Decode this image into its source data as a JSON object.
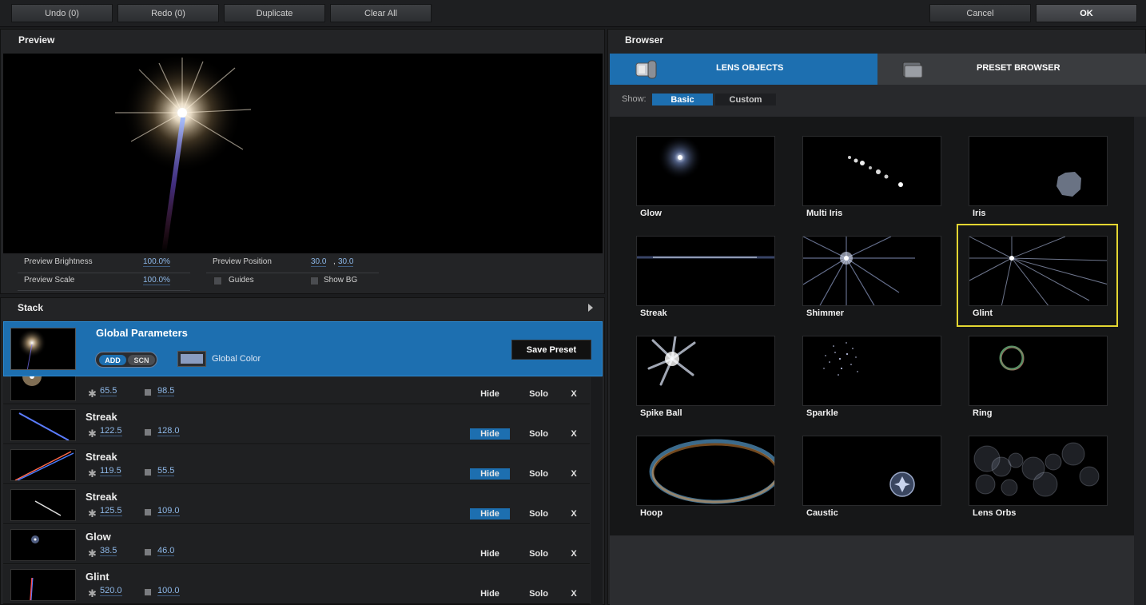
{
  "toolbar": {
    "undo": "Undo (0)",
    "redo": "Redo (0)",
    "duplicate": "Duplicate",
    "clear_all": "Clear All",
    "cancel": "Cancel",
    "ok": "OK"
  },
  "preview": {
    "title": "Preview",
    "brightness_label": "Preview Brightness",
    "brightness_value": "100.0%",
    "scale_label": "Preview Scale",
    "scale_value": "100.0%",
    "position_label": "Preview Position",
    "position_x": "30.0",
    "position_sep": ",",
    "position_y": "30.0",
    "guides_label": "Guides",
    "show_bg_label": "Show BG"
  },
  "stack": {
    "title": "Stack",
    "global": {
      "title": "Global Parameters",
      "add": "ADD",
      "scn": "SCN",
      "color_label": "Global Color",
      "color": "#8a9cc0",
      "save_preset": "Save Preset"
    },
    "rows": [
      {
        "name": "",
        "v1": "65.5",
        "v2": "98.5",
        "hide": "Hide",
        "hide_on": false,
        "solo": "Solo",
        "x": "X"
      },
      {
        "name": "Streak",
        "v1": "122.5",
        "v2": "128.0",
        "hide": "Hide",
        "hide_on": true,
        "solo": "Solo",
        "x": "X"
      },
      {
        "name": "Streak",
        "v1": "119.5",
        "v2": "55.5",
        "hide": "Hide",
        "hide_on": true,
        "solo": "Solo",
        "x": "X"
      },
      {
        "name": "Streak",
        "v1": "125.5",
        "v2": "109.0",
        "hide": "Hide",
        "hide_on": true,
        "solo": "Solo",
        "x": "X"
      },
      {
        "name": "Glow",
        "v1": "38.5",
        "v2": "46.0",
        "hide": "Hide",
        "hide_on": false,
        "solo": "Solo",
        "x": "X"
      },
      {
        "name": "Glint",
        "v1": "520.0",
        "v2": "100.0",
        "hide": "Hide",
        "hide_on": false,
        "solo": "Solo",
        "x": "X"
      }
    ]
  },
  "browser": {
    "title": "Browser",
    "tab_lens": "LENS OBJECTS",
    "tab_preset": "PRESET BROWSER",
    "show_label": "Show:",
    "show_basic": "Basic",
    "show_custom": "Custom",
    "tiles": [
      "Glow",
      "Multi Iris",
      "Iris",
      "Streak",
      "Shimmer",
      "Glint",
      "Spike Ball",
      "Sparkle",
      "Ring",
      "Hoop",
      "Caustic",
      "Lens Orbs"
    ],
    "selected": "Glint",
    "accent": "#1d6fb0",
    "highlight": "#e3d631"
  }
}
